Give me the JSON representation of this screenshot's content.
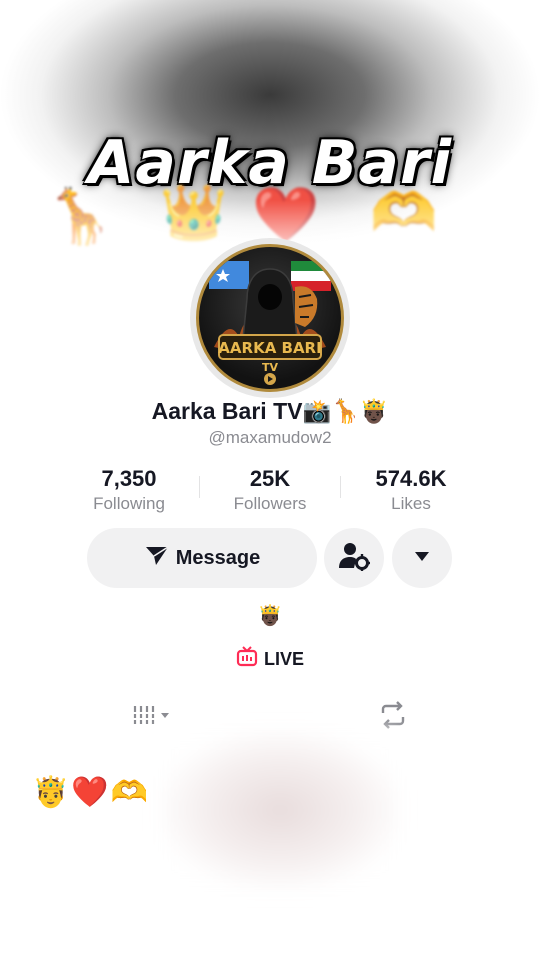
{
  "banner": {
    "title": "Aarka Bari",
    "emojis": [
      "🦒",
      "👑",
      "❤️",
      "🫶"
    ]
  },
  "nav": {
    "back_icon": "back-arrow-icon",
    "bell_icon": "bell-icon",
    "share_icon": "share-icon"
  },
  "profile": {
    "avatar_text": "AARKA BARI",
    "avatar_subtext": "TV",
    "display_name": "Aarka Bari TV📸🦒🤴🏿",
    "username": "@maxamudow2"
  },
  "stats": [
    {
      "value": "7,350",
      "label": "Following"
    },
    {
      "value": "25K",
      "label": "Followers"
    },
    {
      "value": "574.6K",
      "label": "Likes"
    }
  ],
  "actions": {
    "message_label": "Message",
    "add_friend_icon": "person-gear-icon",
    "more_icon": "triangle-down-icon"
  },
  "bio": {
    "emoji": "🤴🏿",
    "live_label": "LIVE"
  },
  "tabs": [
    {
      "icon": "grid-icon"
    },
    {
      "icon": "repost-icon"
    }
  ],
  "post": {
    "caption": "🤴❤️🫶"
  },
  "colors": {
    "text_primary": "#161823",
    "text_secondary": "#8a8b91",
    "button_bg": "#f1f1f2",
    "live_accent": "#fe2c55"
  }
}
